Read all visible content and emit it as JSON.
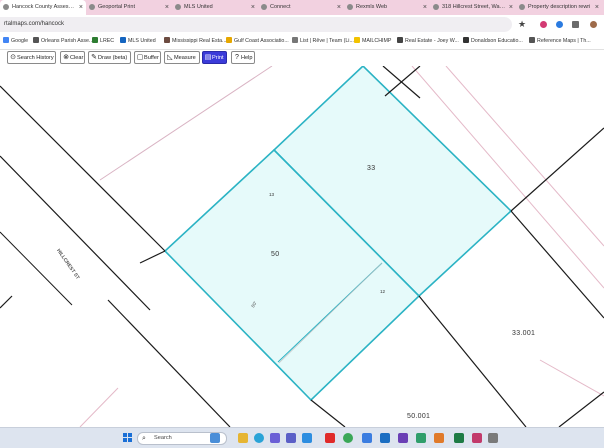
{
  "browser": {
    "tabs": [
      {
        "label": "Hancock County Assessor",
        "active": true
      },
      {
        "label": "Geoportal Print",
        "active": false
      },
      {
        "label": "MLS United",
        "active": false
      },
      {
        "label": "Connect",
        "active": false
      },
      {
        "label": "Rexmls Web",
        "active": false
      },
      {
        "label": "318 Hillcrest Street, Wavel",
        "active": false
      },
      {
        "label": "Property description rewri",
        "active": false
      }
    ],
    "close_glyph": "×",
    "url": "rtalmaps.com/hancock",
    "star_glyph": "★"
  },
  "bookmarks": [
    {
      "label": "Google",
      "icon": "google-icon",
      "color": "#4285f4"
    },
    {
      "label": "Orleans Parish Asse...",
      "icon": "building-icon",
      "color": "#555555"
    },
    {
      "label": "LREC",
      "icon": "lrec-icon",
      "color": "#2e7d32"
    },
    {
      "label": "MLS United",
      "icon": "mls-icon",
      "color": "#1565c0"
    },
    {
      "label": "Mississippi Real Esta...",
      "icon": "seal-icon",
      "color": "#6d4c41"
    },
    {
      "label": "Gulf Coast Associatio...",
      "icon": "gulf-icon",
      "color": "#e6a700"
    },
    {
      "label": "List | Rêve | Team (Li...",
      "icon": "doc-icon",
      "color": "#777777"
    },
    {
      "label": "MAILCHIMP",
      "icon": "mailchimp-icon",
      "color": "#f2c200"
    },
    {
      "label": "Real Estate - Joey W...",
      "icon": "arrow-icon",
      "color": "#444444"
    },
    {
      "label": "Donaldson Educatio...",
      "icon": "donaldson-icon",
      "color": "#333333"
    },
    {
      "label": "Reference Maps | Th...",
      "icon": "map-icon",
      "color": "#555555"
    }
  ],
  "toolbar": {
    "buttons": [
      {
        "label": "Search History",
        "icon": "search-icon",
        "glyph": "⊙"
      },
      {
        "label": "Clear",
        "icon": "clear-icon",
        "glyph": "⊗"
      },
      {
        "label": "Draw (beta)",
        "icon": "pencil-icon",
        "glyph": "✎"
      },
      {
        "label": "Buffer",
        "icon": "buffer-icon",
        "glyph": "▢"
      },
      {
        "label": "Measure",
        "icon": "ruler-icon",
        "glyph": "◺"
      },
      {
        "label": "Print",
        "icon": "printer-icon",
        "glyph": "▤"
      },
      {
        "label": "Help",
        "icon": "help-icon",
        "glyph": "?"
      }
    ]
  },
  "map": {
    "street_name": "HILLCREST ST",
    "lots": {
      "lot_33_north": "33",
      "lot_50": "50",
      "lot_33_001": "33.001",
      "lot_50_001": "50.001"
    },
    "dimensions": {
      "dim_13": "13",
      "dim_12": "12",
      "dim_80": "80'"
    },
    "parcel_fill": "#e6fafa",
    "parcel_stroke": "#2bb3c4"
  },
  "taskbar": {
    "search_placeholder": "Search",
    "search_glyph": "⌕"
  }
}
